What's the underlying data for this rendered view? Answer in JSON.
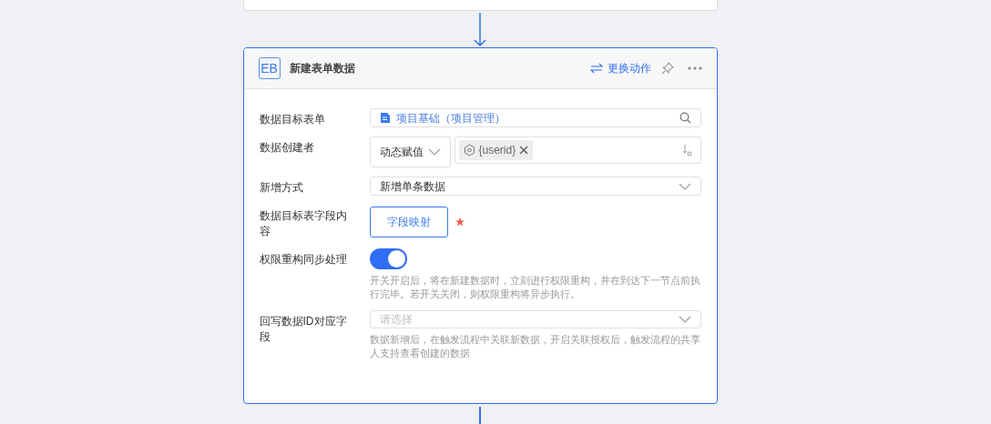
{
  "node": {
    "logo": "EB",
    "title": "新建表单数据",
    "action": "更换动作"
  },
  "fields": [
    {
      "kind": "lookup",
      "label": "数据目标表单",
      "value": "项目基础（项目管理）"
    },
    {
      "kind": "dynamic",
      "label": "数据创建者",
      "mode": "动态赋值",
      "tag": "{userid}"
    },
    {
      "kind": "select",
      "label": "新增方式",
      "value": "新增单条数据"
    },
    {
      "kind": "button",
      "label": "数据目标表字段内容",
      "button": "字段映射",
      "required": true
    },
    {
      "kind": "switch",
      "label": "权限重构同步处理",
      "on": true,
      "help": "开关开启后，将在新建数据时，立刻进行权限重构，并在到达下一节点前执行完毕。若开关关闭，则权限重构将异步执行。"
    },
    {
      "kind": "select",
      "label": "回写数据ID对应字段",
      "placeholder": "请选择",
      "help": "数据新增后，在触发流程中关联新数据，开启关联授权后，触发流程的共享人支持查看创建的数据"
    }
  ]
}
